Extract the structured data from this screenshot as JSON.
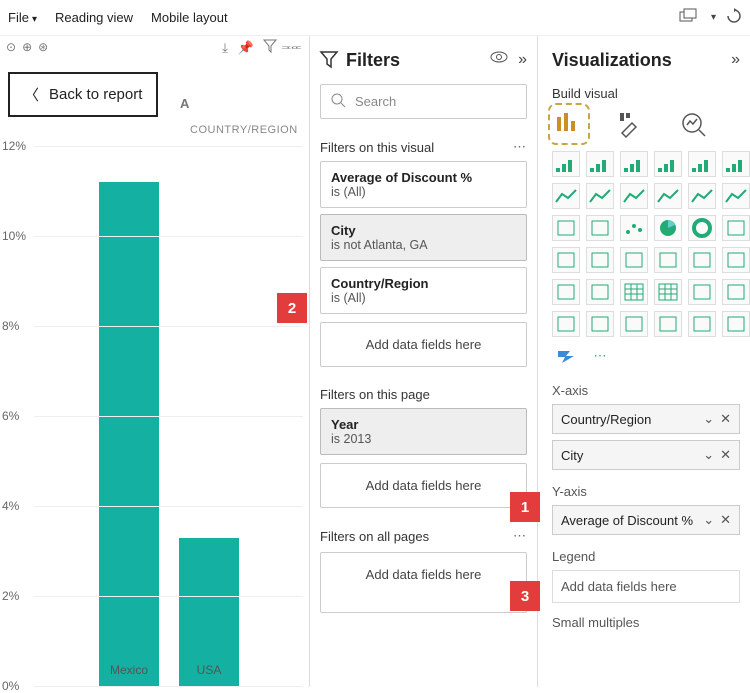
{
  "topbar": {
    "file": "File",
    "reading": "Reading view",
    "mobile": "Mobile layout"
  },
  "canvas": {
    "back": "Back to report",
    "legend_cut": "COUNTRY/REGION"
  },
  "chart_data": {
    "type": "bar",
    "categories": [
      "Mexico",
      "USA"
    ],
    "values": [
      11.2,
      3.3
    ],
    "ylabel": "",
    "xlabel": "",
    "ylim": [
      0,
      12
    ],
    "yticks": [
      "0%",
      "2%",
      "4%",
      "6%",
      "8%",
      "10%",
      "12%"
    ]
  },
  "filters": {
    "title": "Filters",
    "search_placeholder": "Search",
    "sections": {
      "visual": {
        "label": "Filters on this visual",
        "cards": [
          {
            "title": "Average of Discount %",
            "sub": "is (All)",
            "selected": false
          },
          {
            "title": "City",
            "sub": "is not Atlanta, GA",
            "selected": true
          },
          {
            "title": "Country/Region",
            "sub": "is (All)",
            "selected": false
          }
        ],
        "add": "Add data fields here"
      },
      "page": {
        "label": "Filters on this page",
        "cards": [
          {
            "title": "Year",
            "sub": "is 2013",
            "selected": true
          }
        ],
        "add": "Add data fields here"
      },
      "all": {
        "label": "Filters on all pages",
        "add": "Add data fields here"
      }
    }
  },
  "callouts": {
    "c1": "1",
    "c2": "2",
    "c3": "3"
  },
  "viz": {
    "title": "Visualizations",
    "build": "Build visual",
    "xaxis_label": "X-axis",
    "xaxis_pills": [
      "Country/Region",
      "City"
    ],
    "yaxis_label": "Y-axis",
    "yaxis_pills": [
      "Average of Discount %"
    ],
    "legend_label": "Legend",
    "legend_add": "Add data fields here",
    "small_mult": "Small multiples",
    "icon_names": [
      "stacked-bar",
      "stacked-column",
      "clustered-bar",
      "clustered-column",
      "100-bar",
      "100-column",
      "line",
      "area",
      "stacked-area",
      "line-column",
      "line-clustered",
      "ribbon",
      "waterfall",
      "funnel",
      "scatter",
      "pie",
      "donut",
      "treemap",
      "map",
      "filled-map",
      "azure-map",
      "gauge",
      "card",
      "kpi",
      "multi-row",
      "slicer",
      "table",
      "matrix",
      "r-visual",
      "py-visual",
      "key-influencers",
      "decomp",
      "qna",
      "narrative",
      "paginated",
      "power-apps",
      "power-automate",
      "more"
    ]
  }
}
